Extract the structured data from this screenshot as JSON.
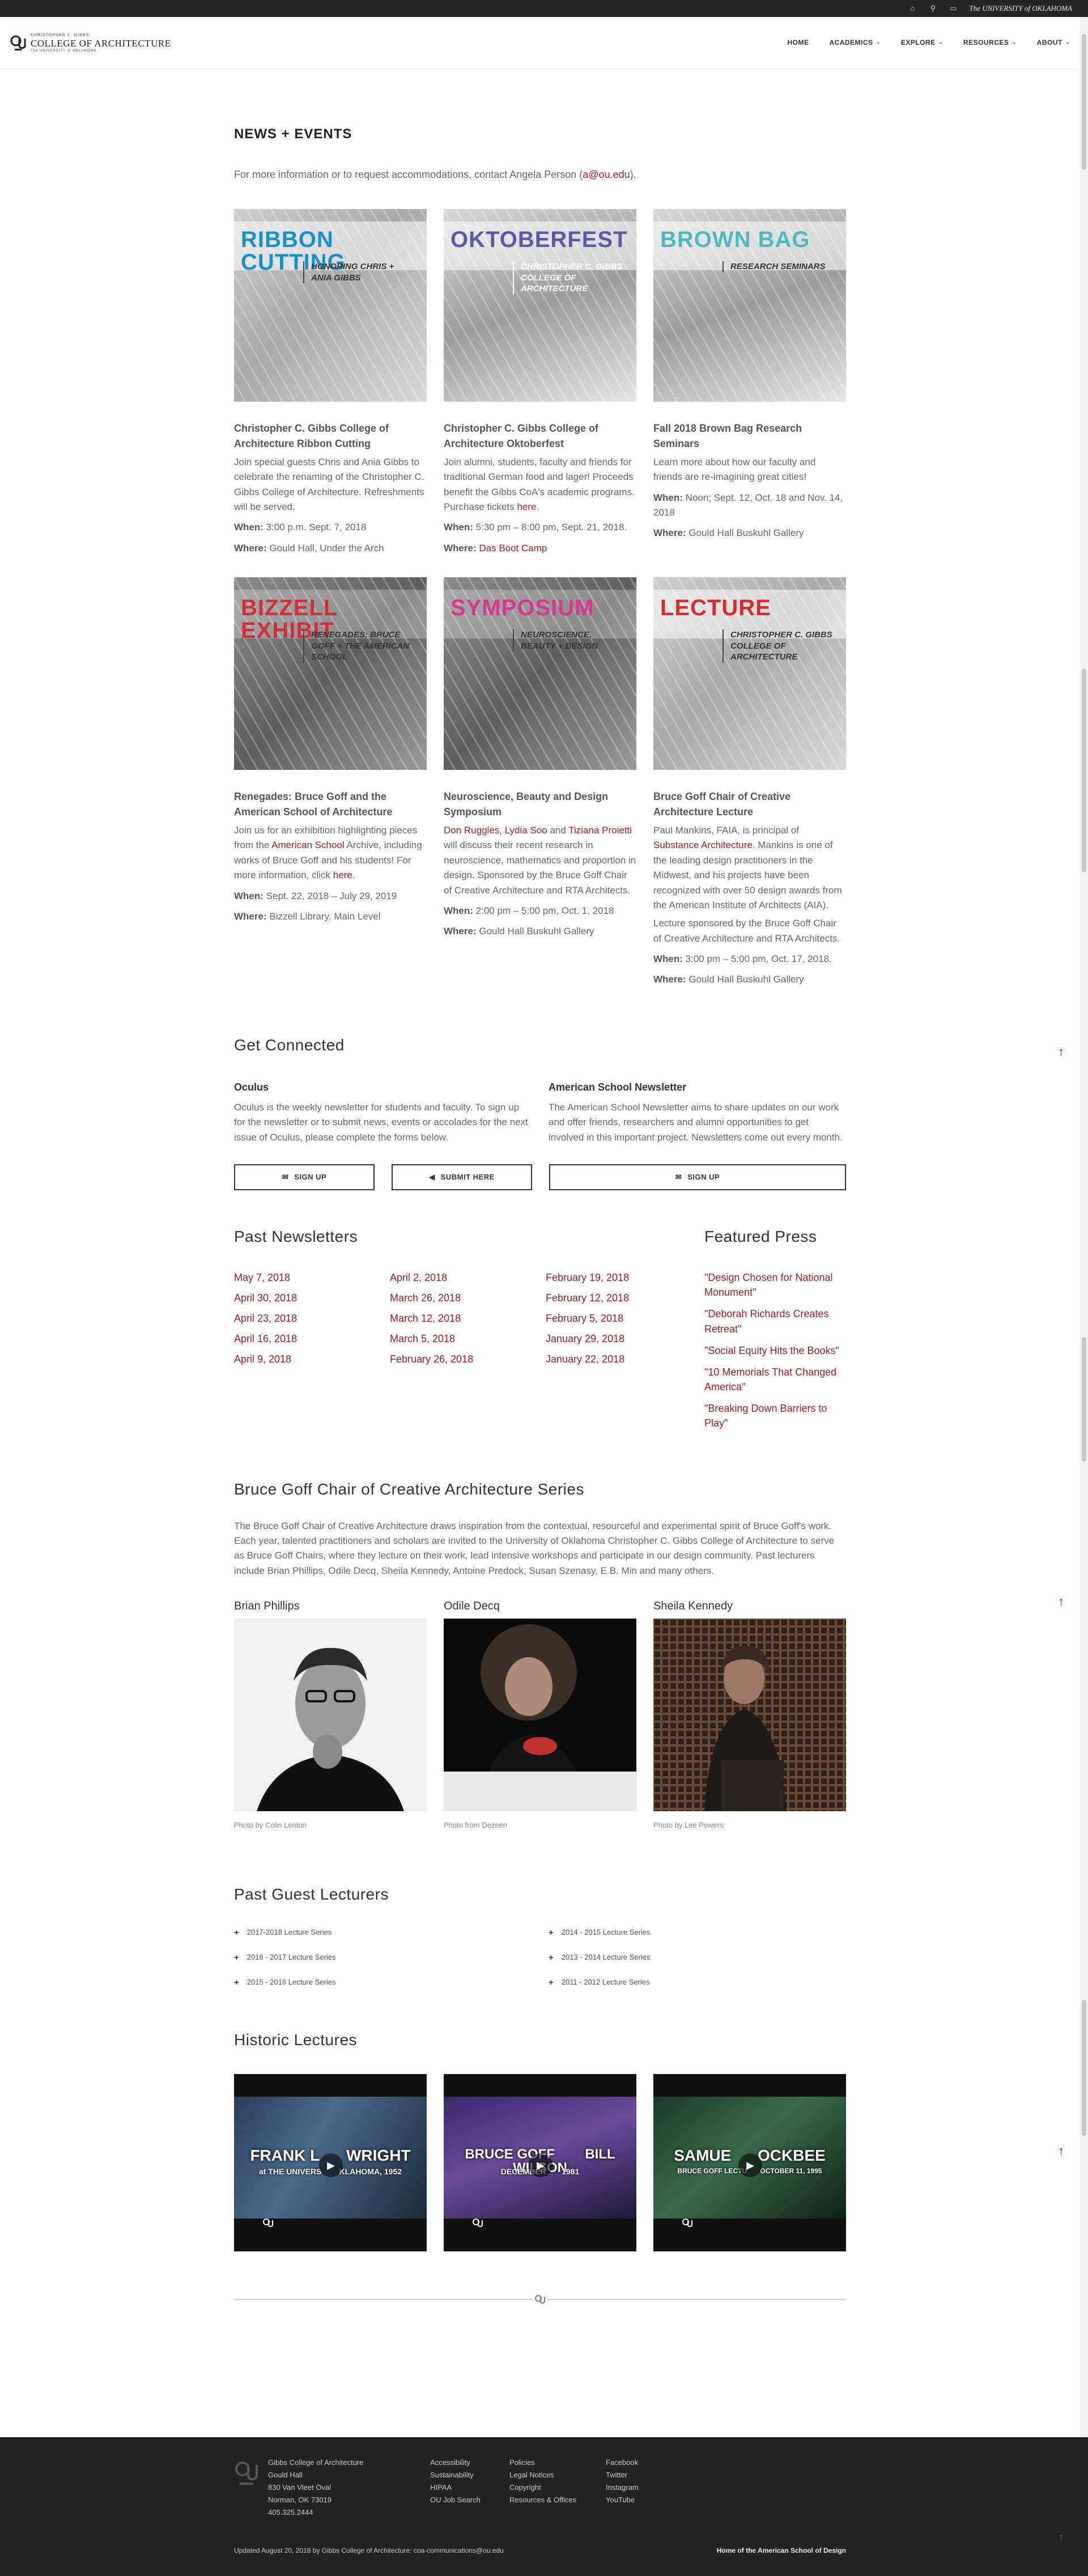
{
  "topbar": {
    "university": "The UNIVERSITY of OKLAHOMA"
  },
  "logo": {
    "line1": "CHRISTOPHER C. GIBBS",
    "line2": "COLLEGE OF ARCHITECTURE",
    "line3": "The UNIVERSITY of OKLAHOMA"
  },
  "nav": [
    {
      "label": "HOME"
    },
    {
      "label": "ACADEMICS"
    },
    {
      "label": "EXPLORE"
    },
    {
      "label": "RESOURCES"
    },
    {
      "label": "ABOUT"
    }
  ],
  "news": {
    "heading": "NEWS + EVENTS",
    "contact_pre": "For more information or to request accommodations, contact Angela Person (",
    "contact_link": "a@ou.edu",
    "contact_post": ")."
  },
  "labels": {
    "when": "When:",
    "where": "Where:"
  },
  "events": [
    {
      "img_title": "RIBBON CUTTING",
      "img_sub": "HONORING CHRIS + ANIA GIBBS",
      "title_color": "#1a90c8",
      "title": "Christopher C. Gibbs College of Architecture Ribbon Cutting",
      "desc": "Join special guests Chris and Ania Gibbs to celebrate the renaming of the Christopher C. Gibbs College of Architecture. Refreshments will be served.",
      "when": "3:00 p.m. Sept. 7, 2018",
      "where": "Gould Hall, Under the Arch"
    },
    {
      "img_title": "OKTOBERFEST",
      "img_sub": "CHRISTOPHER C. GIBBS COLLEGE OF ARCHITECTURE",
      "title_color": "#5a5aa8",
      "title": "Christopher C. Gibbs College of Architecture Oktoberfest",
      "desc": "Join alumni, students, faculty and friends for traditional German food and lager! Proceeds benefit the Gibbs CoA's academic programs. Purchase tickets ",
      "desc_link": "here",
      "desc_post": ".",
      "when": "5:30 pm – 8:00 pm, Sept. 21, 2018.",
      "where_link": "Das Boot Camp"
    },
    {
      "img_title": "BROWN BAG",
      "img_sub": "RESEARCH SEMINARS",
      "title_color": "#4fb8bf",
      "title": "Fall 2018 Brown Bag Research Seminars",
      "desc": "Learn more about how our faculty and friends are re-imagining great cities!",
      "when": "Noon; Sept. 12, Oct. 18 and Nov. 14, 2018",
      "where": "Gould Hall Buskuhl Gallery"
    },
    {
      "img_title": "BIZZELL EXHIBIT",
      "img_sub": "RENEGADES: BRUCE GOFF + THE AMERICAN SCHOOL",
      "title_color": "#d22e3a",
      "title": "Renegades: Bruce Goff and the American School of Architecture",
      "desc": "Join us for an exhibition highlighting pieces from the ",
      "desc_link": "American School",
      "desc_post": " Archive, including works of Bruce Goff and his students! For more information, click ",
      "desc_link2": "here",
      "desc_post2": ".",
      "when": "Sept. 22, 2018 – July 29, 2019",
      "where": "Bizzell Library, Main Level"
    },
    {
      "img_title": "SYMPOSIUM",
      "img_sub": "NEUROSCIENCE, BEAUTY + DESIGN",
      "title_color": "#d9388f",
      "title": "Neuroscience, Beauty and Design Symposium",
      "desc_pre_link": "Don Ruggles",
      "desc_sep1": ", ",
      "desc_link_b": "Lydia Soo",
      "desc_sep2": " and ",
      "desc_link_c": "Tiziana Proietti",
      "desc": " will discuss their recent research in neuroscience, mathematics and proportion in design. Sponsored by the Bruce Goff Chair of Creative Architecture and RTA Architects.",
      "when": "2:00 pm – 5:00 pm, Oct. 1, 2018",
      "where": "Gould Hall Buskuhl Gallery"
    },
    {
      "img_title": "LECTURE",
      "img_sub": "CHRISTOPHER C. GIBBS COLLEGE OF ARCHITECTURE",
      "title_color": "#cf2d32",
      "title": "Bruce Goff Chair of Creative Architecture Lecture",
      "desc": "Paul Mankins, FAIA, is principal of ",
      "desc_link": "Substance Architecture",
      "desc_post": ". Mankins is one of the leading design practitioners in the Midwest, and his projects have been recognized with over 50 design awards from the American Institute of Architects (AIA).",
      "desc2": "Lecture sponsored by the Bruce Goff Chair of Creative Architecture and RTA Architects.",
      "when": "3:00 pm – 5:00 pm, Oct. 17, 2018.",
      "where": "Gould Hall Buskuhl Gallery"
    }
  ],
  "connected": {
    "heading": "Get Connected",
    "oculus_title": "Oculus",
    "oculus_text": "Oculus is the weekly newsletter for students and faculty. To sign up for the newsletter or to submit news, events or accolades for the next issue of Oculus, please complete the forms below.",
    "ams_title": "American School Newsletter",
    "ams_text": "The American School Newsletter aims to share updates on our work and offer friends, researchers and alumni opportunities to get involved in this important project. Newsletters come out every month.",
    "btn_signup": "SIGN UP",
    "btn_submit": "SUBMIT HERE",
    "btn_signup2": "SIGN UP"
  },
  "newsletters": {
    "heading": "Past Newsletters",
    "col1": [
      "May 7, 2018",
      "April 30, 2018",
      "April 23, 2018",
      "April 16, 2018",
      "April 9, 2018"
    ],
    "col2": [
      "April 2, 2018",
      "March 26, 2018",
      "March 12, 2018",
      "March 5, 2018",
      "February 26, 2018"
    ],
    "col3": [
      "February 19, 2018",
      "February 12, 2018",
      "February 5, 2018",
      "January 29, 2018",
      "January 22, 2018"
    ]
  },
  "press": {
    "heading": "Featured Press",
    "items": [
      "\"Design Chosen for National Monument\"",
      "\"Deborah Richards Creates Retreat\"",
      "\"Social Equity Hits the Books\"",
      "\"10 Memorials That Changed America\"",
      "\"Breaking Down Barriers to Play\""
    ]
  },
  "goff": {
    "heading": "Bruce Goff Chair of Creative Architecture Series",
    "intro": "The Bruce Goff Chair of Creative Architecture draws inspiration from the contextual, resourceful and experimental spirit of Bruce Goff's work. Each year, talented practitioners and scholars are invited to the University of Oklahoma Christopher C. Gibbs College of Architecture to serve as Bruce Goff Chairs, where they lecture on their work, lead intensive workshops and participate in our design community. Past lecturers include Brian Phillips, Odile Decq, Sheila Kennedy, Antoine Predock, Susan Szenasy, E.B. Min and many others.",
    "people": [
      {
        "name": "Brian Phillips",
        "credit": "Photo by Colin Lenton"
      },
      {
        "name": "Odile Decq",
        "credit": "Photo from Dezeen"
      },
      {
        "name": "Sheila Kennedy",
        "credit": "Photo by Lee Powers"
      }
    ]
  },
  "guest": {
    "heading": "Past Guest Lecturers",
    "items": [
      "2017-2018 Lecture Series",
      "2014 - 2015 Lecture Series",
      "2016 - 2017 Lecture Series",
      "2013 - 2014 Lecture Series",
      "2015 - 2016 Lecture Series",
      "2011 - 2012 Lecture Series"
    ]
  },
  "historic": {
    "heading": "Historic Lectures",
    "videos": [
      {
        "title": "FRANK L      WRIGHT",
        "sub": "at THE UNIVERS        KLAHOMA, 1952"
      },
      {
        "title": "BRUCE GOFF        BILL WILSON",
        "sub": "DECEMBER       1981"
      },
      {
        "title": "SAMUE      OCKBEE",
        "sub": "BRUCE GOFF LECTU       OCTOBER 11, 1995"
      }
    ]
  },
  "footer": {
    "address": [
      "Gibbs College of Architecture",
      "Gould Hall",
      "830 Van Vleet Oval",
      "Norman, OK 73019",
      "405.325.2444"
    ],
    "col2": [
      "Accessibility",
      "Sustainability",
      "HIPAA",
      "OU Job Search"
    ],
    "col3": [
      "Policies",
      "Legal Notices",
      "Copyright",
      "Resources & Offices"
    ],
    "col4": [
      "Facebook",
      "Twitter",
      "Instagram",
      "YouTube"
    ],
    "updated_pre": "Updated August 20, 2018 by Gibbs College of Architecture: ",
    "updated_link": "coa-communications@ou.edu",
    "right": "Home of the American School of Design"
  }
}
